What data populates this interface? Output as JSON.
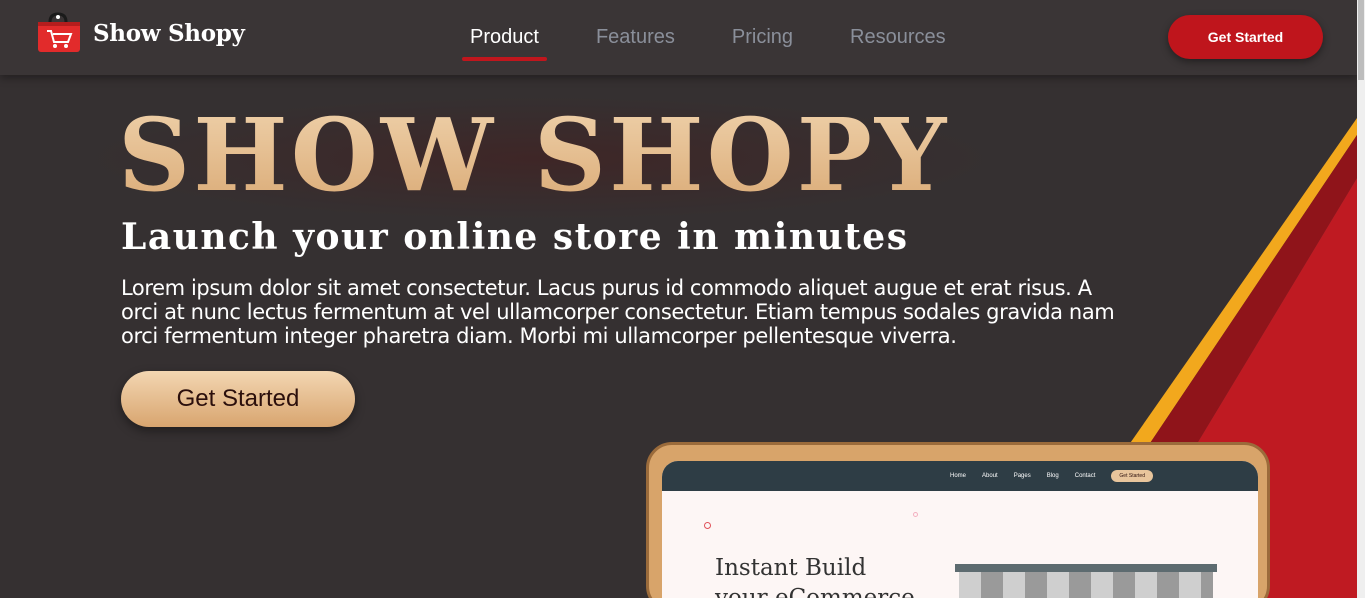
{
  "brand": {
    "name": "Show Shopy",
    "logo_icon": "shopping-bag-cart-icon"
  },
  "nav": {
    "links": [
      {
        "label": "Product",
        "active": true
      },
      {
        "label": "Features",
        "active": false
      },
      {
        "label": "Pricing",
        "active": false
      },
      {
        "label": "Resources",
        "active": false
      }
    ],
    "cta_label": "Get Started"
  },
  "hero": {
    "title": "SHOW SHOPY",
    "subtitle": "Launch your online store in minutes",
    "description": "Lorem ipsum dolor sit amet consectetur. Lacus purus id commodo aliquet augue et erat risus. A orci at nunc lectus fermentum at vel ullamcorper consectetur. Etiam tempus sodales gravida nam orci fermentum integer pharetra diam. Morbi mi ullamcorper pellentesque viverra.",
    "cta_label": "Get Started"
  },
  "mockup": {
    "nav_links": [
      "Home",
      "About",
      "Pages",
      "Blog",
      "Contact"
    ],
    "nav_button": "Get Started",
    "headline_line1": "Instant Build",
    "headline_line2": "your eCommerce"
  },
  "colors": {
    "background": "#353031",
    "accent_red": "#bf151c",
    "accent_gold": "#f2a81d",
    "title_gold": "#e4b887"
  }
}
